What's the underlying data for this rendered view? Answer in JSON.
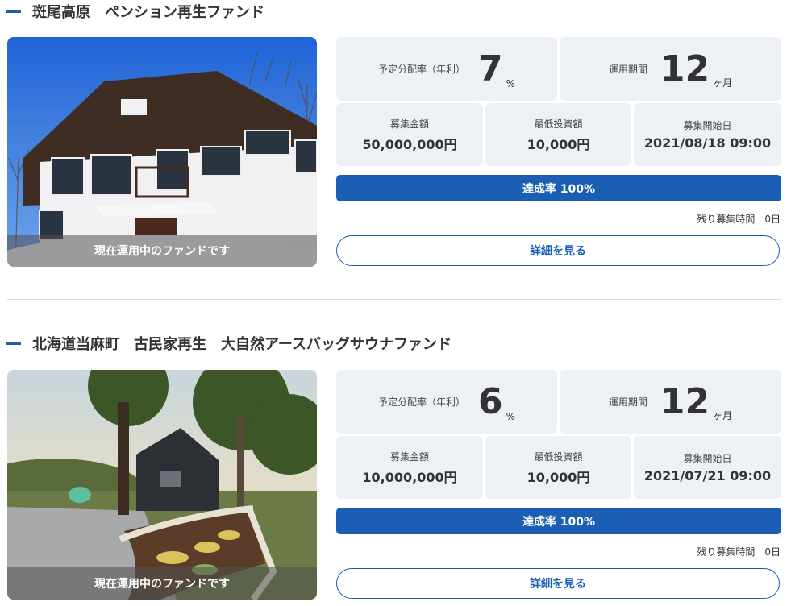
{
  "funds": [
    {
      "title": "斑尾高原　ペンション再生ファンド",
      "photo_caption": "現在運用中のファンドです",
      "rate_label": "予定分配率（年利）",
      "rate_value": "7",
      "rate_unit": "%",
      "period_label": "運用期間",
      "period_value": "12",
      "period_unit": "ヶ月",
      "amount_label": "募集金額",
      "amount_value": "50,000,000円",
      "min_label": "最低投資額",
      "min_value": "10,000円",
      "start_label": "募集開始日",
      "start_value": "2021/08/18 09:00",
      "progress_text": "達成率 100%",
      "progress_percent": 100,
      "remaining_text": "残り募集時間　0日",
      "detail_button": "詳細を見る"
    },
    {
      "title": "北海道当麻町　古民家再生　大自然アースバッグサウナファンド",
      "photo_caption": "現在運用中のファンドです",
      "rate_label": "予定分配率（年利）",
      "rate_value": "6",
      "rate_unit": "%",
      "period_label": "運用期間",
      "period_value": "12",
      "period_unit": "ヶ月",
      "amount_label": "募集金額",
      "amount_value": "10,000,000円",
      "min_label": "最低投資額",
      "min_value": "10,000円",
      "start_label": "募集開始日",
      "start_value": "2021/07/21 09:00",
      "progress_text": "達成率 100%",
      "progress_percent": 100,
      "remaining_text": "残り募集時間　0日",
      "detail_button": "詳細を見る"
    }
  ],
  "colors": {
    "accent": "#1b5fb5",
    "box_bg": "#edf1f6",
    "divider": "#dcdcdc"
  }
}
